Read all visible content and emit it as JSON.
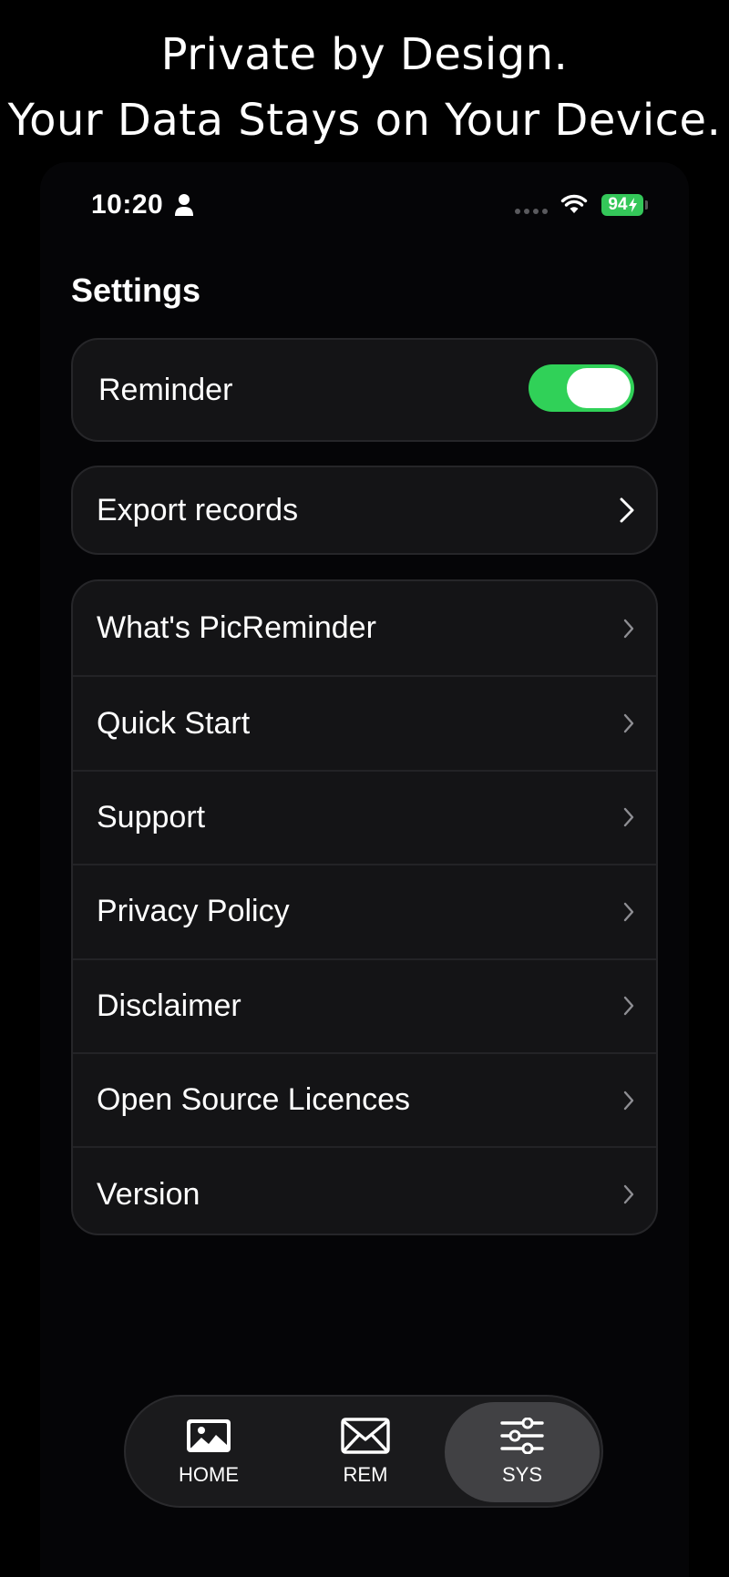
{
  "headline": {
    "line1": "Private by Design.",
    "line2": "Your Data Stays on Your Device."
  },
  "status_bar": {
    "time": "10:20",
    "battery": "94",
    "icons": [
      "person-icon",
      "signal-icon",
      "wifi-icon",
      "battery-icon"
    ]
  },
  "settings": {
    "title": "Settings",
    "reminder": {
      "label": "Reminder",
      "enabled": true
    },
    "export": {
      "label": "Export records"
    },
    "items": [
      {
        "label": "What's PicReminder"
      },
      {
        "label": "Quick Start"
      },
      {
        "label": "Support"
      },
      {
        "label": "Privacy Policy"
      },
      {
        "label": "Disclaimer"
      },
      {
        "label": "Open Source Licences"
      },
      {
        "label": "Version"
      }
    ]
  },
  "tabbar": {
    "tabs": [
      {
        "label": "HOME",
        "icon": "image-icon",
        "active": false
      },
      {
        "label": "REM",
        "icon": "envelope-icon",
        "active": false
      },
      {
        "label": "SYS",
        "icon": "sliders-icon",
        "active": true
      }
    ]
  },
  "colors": {
    "background": "#000000",
    "card": "#141416",
    "toggle_on": "#30d158",
    "battery": "#34c759",
    "active_tab": "#414144"
  }
}
